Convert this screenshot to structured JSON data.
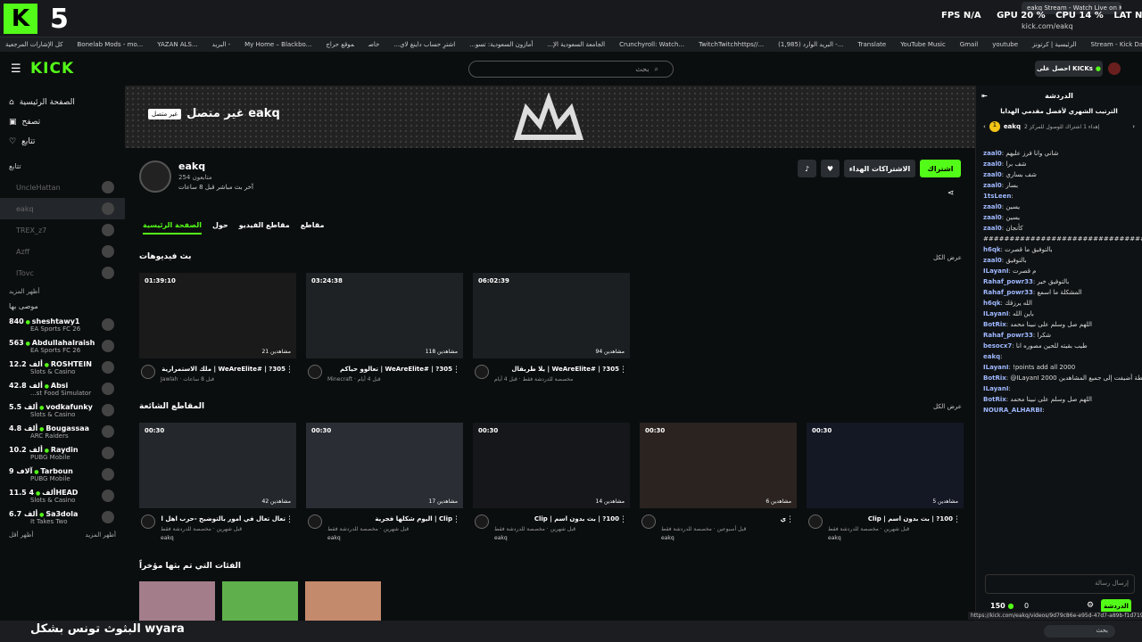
{
  "browser": {
    "tab_title": "eakq Stream - Watch Live on Ki",
    "url": "kick.com/eakq",
    "stats": {
      "fps": "FPS N/A",
      "gpu": "GPU 20 %",
      "cpu": "CPU 14 %",
      "lat": "LAT N/A"
    },
    "overlay_num": "5",
    "bookmarks": [
      "كل الإشارات المرجعية",
      "Bonelab Mods - mo...",
      "YAZAN ALS...",
      "البريد -",
      "My Home – Blackbo...",
      "الجامعة السعودية الإ...",
      "أمازون السعودية: تسو...",
      "اشترِ حساب داينغ لاي...",
      "خاص",
      "موقع حراج",
      "Crunchyroll: Watch...",
      "TwitchTwitchhttps//...",
      "(1,985) البريد الوارد -...",
      "Translate",
      "YouTube Music",
      "Gmail",
      "youtube",
      "الرئيسية | كرتونز",
      "Stream - Kick Dashb...",
      "Kick",
      "Google"
    ]
  },
  "header": {
    "logo": "KICK",
    "search_placeholder": "بحث",
    "kicks_button": "احصل على KICKs"
  },
  "sidebar": {
    "nav": [
      "الصفحة الرئيسية",
      "تصفح",
      "تتابع"
    ],
    "following_title": "تتابع",
    "following": [
      "UncleHattan",
      "eakq",
      "TREX_z7",
      "Azff",
      "ITovc"
    ],
    "show_more": "أظهر المزيد",
    "recommended_title": "موصى بها",
    "recommended": [
      {
        "name": "sheshtawy1",
        "viewers": "840",
        "game": "EA Sports FC 26"
      },
      {
        "name": "Abdullahalraish",
        "viewers": "563",
        "game": "EA Sports FC 26"
      },
      {
        "name": "ROSHTEIN",
        "viewers": "12.2 ألف",
        "game": "Slots & Casino"
      },
      {
        "name": "Absi",
        "viewers": "42.8 ألف",
        "game": "...st Food Simulator"
      },
      {
        "name": "vodkafunky",
        "viewers": "5.5 ألف",
        "game": "Slots & Casino"
      },
      {
        "name": "Bougassaa",
        "viewers": "4.8 ألف",
        "game": "ARC Raiders"
      },
      {
        "name": "Raydin",
        "viewers": "10.2 ألف",
        "game": "PUBG Mobile"
      },
      {
        "name": "Tarboun",
        "viewers": "9 آلاف",
        "game": "PUBG Mobile"
      },
      {
        "name": "4HEAD",
        "viewers": "11.5 ألف",
        "game": "Slots & Casino"
      },
      {
        "name": "Sa3dola",
        "viewers": "6.7 ألف",
        "game": "It Takes Two"
      }
    ],
    "show_less": "أظهر أقل",
    "show_more2": "أظهر المزيد"
  },
  "channel": {
    "offline_label": "غير متصل",
    "offline_title": "eakq غير متصل",
    "name": "eakq",
    "followers": "254 متابعون",
    "last_live": "آخر بث مباشر قبل 8 ساعات",
    "subscribe": "اشتراك",
    "gift_subs": "الاشتراكات الهداء",
    "tabs": [
      "الصفحة الرئيسية",
      "حول",
      "مقاطع الفيديو",
      "مقاطع"
    ]
  },
  "sections": {
    "vods": "بث فيديوهات",
    "clips": "المقاطع الشائعة",
    "categories": "الفئات التي تم بثها مؤخراً",
    "show_all": "عرض الكل"
  },
  "vods": [
    {
      "duration": "01:39:10",
      "views": "21 مشاهدين",
      "title": "305? | #WeAreElite | ملك الاستمرارية",
      "sub": "Jawlah · قبل 8 ساعات"
    },
    {
      "duration": "03:24:38",
      "views": "118 مشاهدين",
      "title": "305? | #WeAreElite | تعالوو حياكم",
      "sub": "Minecraft · قبل 4 أيام"
    },
    {
      "duration": "06:02:39",
      "views": "94 مشاهدين",
      "title": "305? | #WeAreElite | يلا طربقال",
      "sub": "مخصصة للدردشة فقط · قبل 4 أيام"
    }
  ],
  "clips": [
    {
      "duration": "00:30",
      "views": "42 مشاهدين",
      "title": "تعال تعال في أمور بالتوضيح -حرب اهل الصعيد...",
      "sub": "قبل شهرين · مخصصة للدردشة فقط",
      "author": "eakq"
    },
    {
      "duration": "00:30",
      "views": "17 مشاهدين",
      "title": "Clip | اليوم شكلها فجرية",
      "sub": "قبل شهرين · مخصصة للدردشة فقط",
      "author": "eakq"
    },
    {
      "duration": "00:30",
      "views": "14 مشاهدين",
      "title": "100? | بث بدون اسم | Clip",
      "sub": "قبل شهرين · مخصصة للدردشة فقط",
      "author": "eakq"
    },
    {
      "duration": "00:30",
      "views": "6 مشاهدين",
      "title": "ي",
      "sub": "قبل أسبوعين · مخصصة للدردشة فقط",
      "author": "eakq"
    },
    {
      "duration": "00:30",
      "views": "5 مشاهدين",
      "title": "100? | بث بدون اسم | Clip",
      "sub": "قبل شهرين · مخصصة للدردشة فقط",
      "author": "eakq"
    }
  ],
  "chat": {
    "title": "الدردشة",
    "leaderboard": "الترتيب الشهري لأفضل مقدمي الهدايا",
    "gifter": "eakq",
    "gifter_note": "إهداء 1 اشتراك للوصول للمركز 2",
    "messages": [
      {
        "user": "zaal0",
        "text": "شاني وانا فرز عليهم"
      },
      {
        "user": "zaal0",
        "text": "شف برا"
      },
      {
        "user": "zaal0",
        "text": "شف بساري"
      },
      {
        "user": "zaal0",
        "text": "بسار"
      },
      {
        "user": "1tsLeen",
        "text": ""
      },
      {
        "user": "zaal0",
        "text": "يسين"
      },
      {
        "user": "zaal0",
        "text": "يسين"
      },
      {
        "user": "zaal0",
        "text": "كأنجان"
      },
      {
        "user": "",
        "text": "######################################"
      },
      {
        "user": "h6qk",
        "text": "بالتوفيق ما قصرت"
      },
      {
        "user": "zaal0",
        "text": "بالتوفيق"
      },
      {
        "user": "ILayanI",
        "text": "م قصرت"
      },
      {
        "user": "Rahaf_powr33",
        "text": "بالتوفيق خير"
      },
      {
        "user": "Rahaf_powr33",
        "text": "المشكلة ما اسمع"
      },
      {
        "user": "h6qk",
        "text": "الله يرزقك"
      },
      {
        "user": "ILayanI",
        "text": "باين الله"
      },
      {
        "user": "BotRix",
        "text": "اللهم صل وسلم على نبينا محمد"
      },
      {
        "user": "Rahaf_powr33",
        "text": "شكرا"
      },
      {
        "user": "besocx7",
        "text": "طيب بقيته للحين مصوره انا"
      },
      {
        "user": "eakq",
        "text": ""
      },
      {
        "user": "ILayanI",
        "text": "!points add all 2000"
      },
      {
        "user": "BotRix",
        "text": "@ILayanI 2000 نقطة أضيفت إلى جميع المشاهدين"
      },
      {
        "user": "ILayanI",
        "text": ""
      },
      {
        "user": "BotRix",
        "text": "اللهم صل وسلم على نبينا محمد"
      },
      {
        "user": "NOURA_ALHARBI",
        "text": ""
      }
    ],
    "input_placeholder": "إرسال رسالة",
    "points": "150",
    "zero": "0",
    "chat_button": "الدردشة"
  },
  "status_url": "https://kick.com/eakq/videos/9d79c86e-e95d-47d7-a89b-f1d7194c59c4",
  "overlay_text": "البثوث تونس بشكل wyara",
  "taskbar_search": "بحث"
}
